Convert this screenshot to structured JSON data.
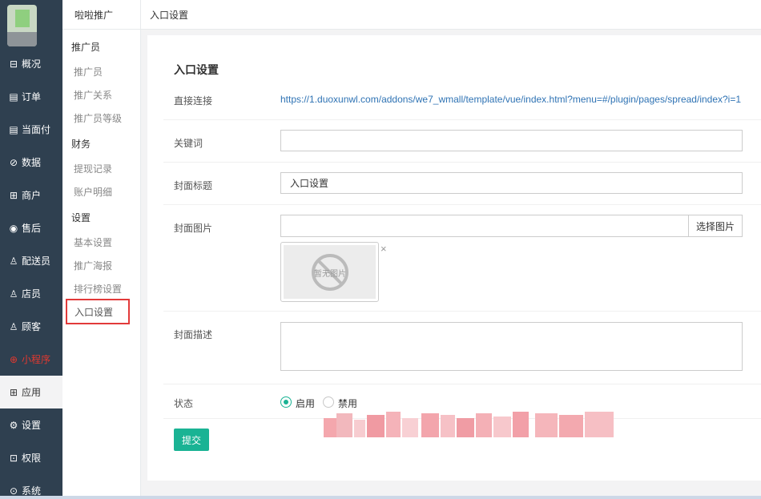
{
  "sidebar": {
    "items": [
      {
        "label": "概况",
        "icon": "overview-icon",
        "glyph": "⊟"
      },
      {
        "label": "订单",
        "icon": "order-icon",
        "glyph": "▤"
      },
      {
        "label": "当面付",
        "icon": "pay-icon",
        "glyph": "▤"
      },
      {
        "label": "数据",
        "icon": "data-icon",
        "glyph": "⊘"
      },
      {
        "label": "商户",
        "icon": "shop-icon",
        "glyph": "⊞"
      },
      {
        "label": "售后",
        "icon": "aftersale-icon",
        "glyph": "◉"
      },
      {
        "label": "配送员",
        "icon": "courier-icon",
        "glyph": "♙"
      },
      {
        "label": "店员",
        "icon": "clerk-icon",
        "glyph": "♙"
      },
      {
        "label": "顾客",
        "icon": "customer-icon",
        "glyph": "♙"
      },
      {
        "label": "小程序",
        "icon": "miniprogram-icon",
        "glyph": "⊕"
      },
      {
        "label": "应用",
        "icon": "apps-icon",
        "glyph": "⊞"
      },
      {
        "label": "设置",
        "icon": "settings-icon",
        "glyph": "⚙"
      },
      {
        "label": "权限",
        "icon": "lock-icon",
        "glyph": "⊡"
      },
      {
        "label": "系统",
        "icon": "system-icon",
        "glyph": "⊙"
      }
    ]
  },
  "submenu": {
    "title": "啦啦推广",
    "groups": [
      {
        "title": "推广员",
        "links": [
          "推广员",
          "推广关系",
          "推广员等级"
        ]
      },
      {
        "title": "财务",
        "links": [
          "提现记录",
          "账户明细"
        ]
      },
      {
        "title": "设置",
        "links": [
          "基本设置",
          "推广海报",
          "排行榜设置",
          "入口设置"
        ]
      }
    ]
  },
  "header": {
    "breadcrumb": "入口设置"
  },
  "form": {
    "title": "入口设置",
    "direct_link_label": "直接连接",
    "direct_link_url": "https://1.duoxunwl.com/addons/we7_wmall/template/vue/index.html?menu=#/plugin/pages/spread/index?i=1",
    "keyword_label": "关键词",
    "keyword_value": "",
    "cover_title_label": "封面标题",
    "cover_title_value": "入口设置",
    "cover_image_label": "封面图片",
    "cover_image_value": "",
    "choose_image_button": "选择图片",
    "no_image_text": "暂无图片",
    "remove_symbol": "×",
    "cover_desc_label": "封面描述",
    "cover_desc_value": "",
    "status_label": "状态",
    "status_options": [
      "启用",
      "禁用"
    ],
    "status_selected": "启用",
    "submit_label": "提交"
  },
  "colors": {
    "sidebar_bg": "#2f4050",
    "accent": "#1ab394",
    "link": "#2f73b4",
    "highlight_border": "#e23a3a"
  }
}
